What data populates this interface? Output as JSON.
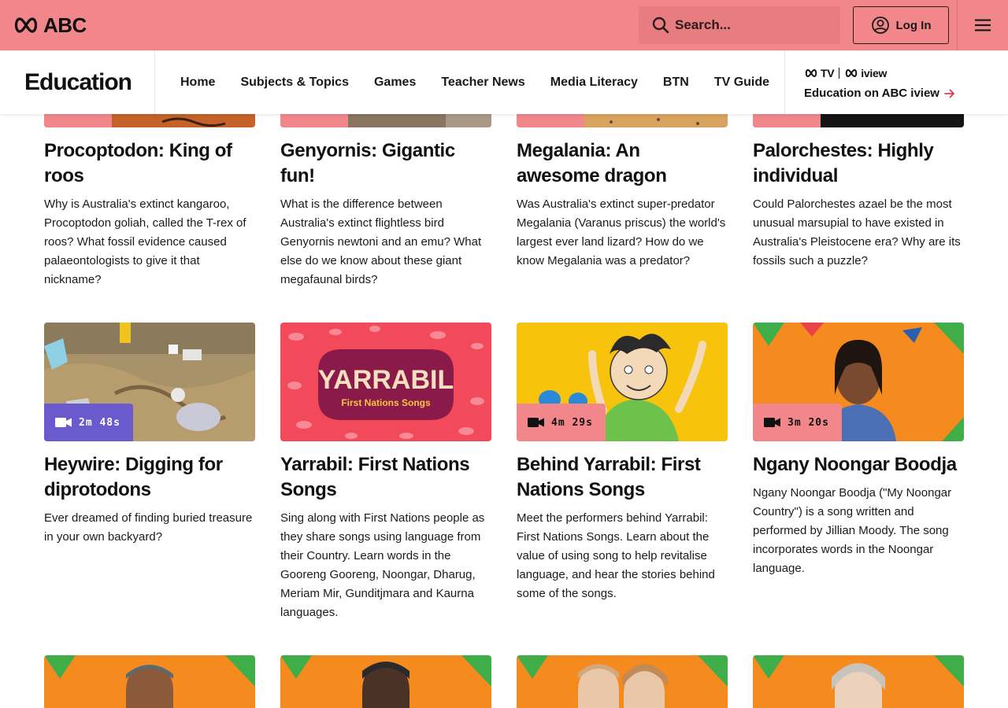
{
  "header": {
    "brand": "ABC",
    "search_placeholder": "Search...",
    "login_label": "Log In",
    "menu_icon": "hamburger-menu-icon"
  },
  "section_nav": {
    "title": "Education",
    "links": [
      "Home",
      "Subjects & Topics",
      "Games",
      "Teacher News",
      "Media Literacy",
      "BTN",
      "TV Guide"
    ],
    "iview": {
      "logo_tv": "TV",
      "logo_iview": "iview",
      "link_label": "Education on ABC iview"
    }
  },
  "colors": {
    "topbar": "#f2878b",
    "badge_pink": "#f2878b",
    "badge_purple": "#6a5acd"
  },
  "cards_row1": [
    {
      "title": "Procoptodon: King of roos",
      "description": "Why is Australia's extinct kangaroo, Procoptodon goliah, called the T-rex of roos? What fossil evidence caused palaeontologists to give it that nickname?"
    },
    {
      "title": "Genyornis: Gigantic fun!",
      "description": "What is the difference between Australia's extinct flightless bird Genyornis newtoni and an emu? What else do we know about these giant megafaunal birds?"
    },
    {
      "title": "Megalania: An awesome dragon",
      "description": "Was Australia's extinct super-predator Megalania (Varanus priscus) the world's largest ever land lizard? How do we know Megalania was a predator?"
    },
    {
      "title": "Palorchestes: Highly individual",
      "description": "Could Palorchestes azael be the most unusual marsupial to have existed in Australia's Pleistocene era? Why are its fossils such a puzzle?"
    }
  ],
  "cards_row2": [
    {
      "title": "Heywire: Digging for diprotodons",
      "description": "Ever dreamed of finding buried treasure in your own backyard?",
      "duration": "2m 48s",
      "badge_icon": "video-camera-icon"
    },
    {
      "title": "Yarrabil: First Nations Songs",
      "description": "Sing along with First Nations people as they share songs using language from their Country. Learn words in the Gooreng Gooreng, Noongar, Dharug, Meriam Mir, Gunditjmara and Kaurna languages.",
      "art_title": "YARRABIL",
      "art_subtitle": "First Nations Songs"
    },
    {
      "title": "Behind Yarrabil: First Nations Songs",
      "description": "Meet the performers behind Yarrabil: First Nations Songs. Learn about the value of using song to help revitalise language, and hear the stories behind some of the songs.",
      "duration": "4m 29s",
      "badge_icon": "video-camera-icon"
    },
    {
      "title": "Ngany Noongar Boodja",
      "description": "Ngany Noongar Boodja (\"My Noongar Country\") is a song written and performed by Jillian Moody. The song incorporates words in the Noongar language.",
      "duration": "3m 20s",
      "badge_icon": "video-camera-icon"
    }
  ]
}
